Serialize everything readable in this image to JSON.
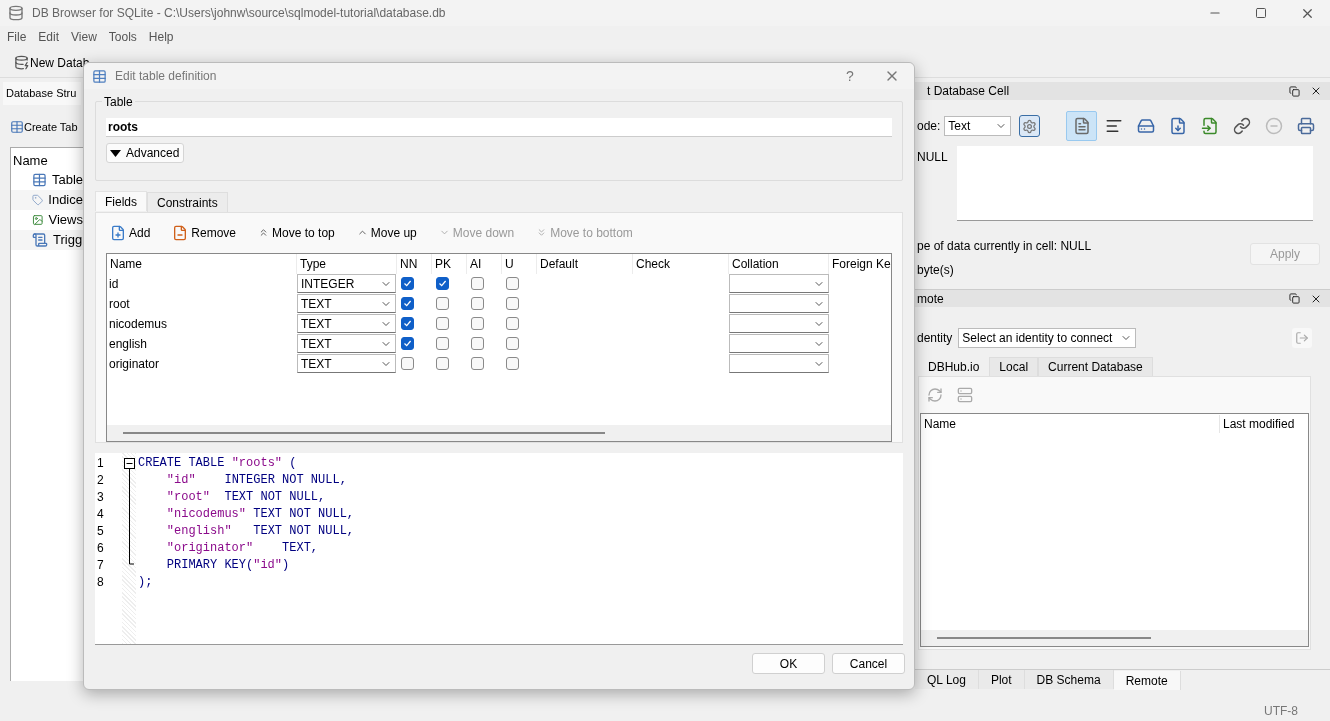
{
  "window": {
    "title": "DB Browser for SQLite - C:\\Users\\johnw\\source\\sqlmodel-tutorial\\database.db"
  },
  "menu": [
    "File",
    "Edit",
    "View",
    "Tools",
    "Help"
  ],
  "toolbar": [
    {
      "label": "New Datab"
    }
  ],
  "structure_panel": {
    "tab": "Database Stru",
    "create_button": "Create Tab",
    "tree_header": "Name",
    "items": [
      {
        "label": "Table",
        "kind": "table"
      },
      {
        "label": "Indice",
        "kind": "index"
      },
      {
        "label": "Views",
        "kind": "view"
      },
      {
        "label": "Trigg",
        "kind": "trigger"
      }
    ]
  },
  "edit_cell": {
    "title": "t Database Cell",
    "mode_label": "ode:",
    "mode_value": "Text",
    "tools": [
      {
        "kind": "text",
        "selected": true
      },
      {
        "kind": "wrap",
        "selected": false
      },
      {
        "kind": "import",
        "selected": false
      },
      {
        "kind": "export",
        "selected": false
      },
      {
        "kind": "save",
        "selected": false
      },
      {
        "kind": "open",
        "selected": false
      },
      {
        "kind": "null",
        "selected": false
      },
      {
        "kind": "print",
        "selected": false
      }
    ],
    "null_label": "NULL",
    "type_text": "pe of data currently in cell: NULL",
    "size_text": "byte(s)",
    "apply": {
      "label": "Apply",
      "disabled": true
    }
  },
  "remote": {
    "title": "mote",
    "identity_label": "dentity",
    "identity_value": "Select an identity to connect",
    "tabs": [
      {
        "label": "DBHub.io",
        "selected": true
      },
      {
        "label": "Local",
        "selected": false
      },
      {
        "label": "Current Database",
        "selected": false
      }
    ],
    "columns": [
      "Name",
      "Last modified"
    ]
  },
  "bottom_tabs": [
    {
      "label": "QL Log",
      "selected": false
    },
    {
      "label": "Plot",
      "selected": false
    },
    {
      "label": "DB Schema",
      "selected": false
    },
    {
      "label": "Remote",
      "selected": true
    }
  ],
  "status_bar": {
    "encoding": "UTF-8"
  },
  "dialog": {
    "title": "Edit table definition",
    "help": "?",
    "group_title": "Table",
    "table_name": "roots",
    "advanced": "Advanced",
    "tabs": [
      {
        "label": "Fields",
        "selected": true
      },
      {
        "label": "Constraints",
        "selected": false
      }
    ],
    "actions": [
      {
        "label": "Add",
        "kind": "add",
        "disabled": false
      },
      {
        "label": "Remove",
        "kind": "remove",
        "disabled": false
      },
      {
        "label": "Move to top",
        "kind": "top",
        "disabled": false
      },
      {
        "label": "Move up",
        "kind": "up",
        "disabled": false
      },
      {
        "label": "Move down",
        "kind": "down",
        "disabled": true
      },
      {
        "label": "Move to bottom",
        "kind": "bottom",
        "disabled": true
      }
    ],
    "columns": [
      "Name",
      "Type",
      "NN",
      "PK",
      "AI",
      "U",
      "Default",
      "Check",
      "Collation",
      "Foreign Ke"
    ],
    "rows": [
      {
        "name": "id",
        "type": "INTEGER",
        "nn": true,
        "pk": true,
        "ai": false,
        "u": false
      },
      {
        "name": "root",
        "type": "TEXT",
        "nn": true,
        "pk": false,
        "ai": false,
        "u": false
      },
      {
        "name": "nicodemus",
        "type": "TEXT",
        "nn": true,
        "pk": false,
        "ai": false,
        "u": false
      },
      {
        "name": "english",
        "type": "TEXT",
        "nn": true,
        "pk": false,
        "ai": false,
        "u": false
      },
      {
        "name": "originator",
        "type": "TEXT",
        "nn": false,
        "pk": false,
        "ai": false,
        "u": false
      }
    ],
    "sql": [
      {
        "number": "1",
        "code": "CREATE TABLE \"roots\" ("
      },
      {
        "number": "2",
        "code": "    \"id\"    INTEGER NOT NULL,"
      },
      {
        "number": "3",
        "code": "    \"root\"  TEXT NOT NULL,"
      },
      {
        "number": "4",
        "code": "    \"nicodemus\" TEXT NOT NULL,"
      },
      {
        "number": "5",
        "code": "    \"english\"   TEXT NOT NULL,"
      },
      {
        "number": "6",
        "code": "    \"originator\"    TEXT,"
      },
      {
        "number": "7",
        "code": "    PRIMARY KEY(\"id\")"
      },
      {
        "number": "8",
        "code": ");"
      }
    ],
    "buttons": [
      "OK",
      "Cancel"
    ]
  }
}
